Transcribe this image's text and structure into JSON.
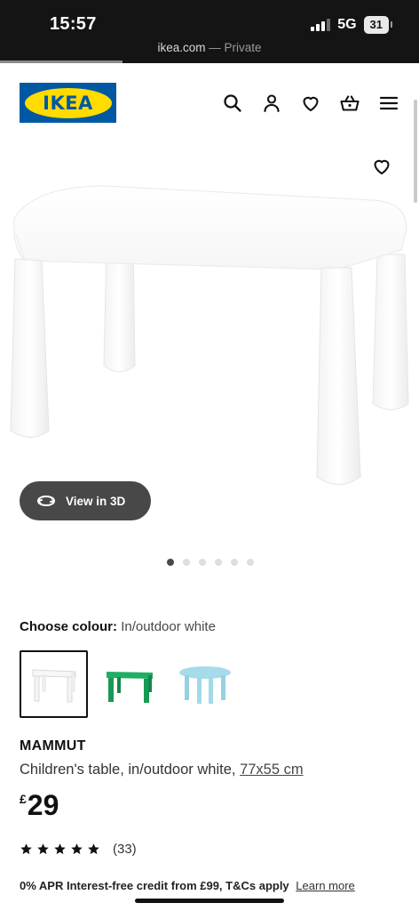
{
  "status_bar": {
    "time": "15:57",
    "network": "5G",
    "battery": "31"
  },
  "browser": {
    "domain": "ikea.com",
    "mode": "— Private"
  },
  "header": {
    "logo_text": "IKEA",
    "icons": [
      "search-icon",
      "user-icon",
      "heart-icon",
      "basket-icon",
      "menu-icon"
    ]
  },
  "hero": {
    "view_3d_label": "View in 3D",
    "carousel": {
      "total": 6,
      "active": 1
    }
  },
  "colour": {
    "label": "Choose colour:",
    "value": "In/outdoor white",
    "swatches": [
      {
        "name": "white",
        "color": "#f7f7f7",
        "shape": "rectangle",
        "selected": true
      },
      {
        "name": "green",
        "color": "#1fae63",
        "shape": "rectangle",
        "selected": false
      },
      {
        "name": "light-blue",
        "color": "#a6dce9",
        "shape": "round",
        "selected": false
      }
    ]
  },
  "product": {
    "name": "MAMMUT",
    "description": "Children's table, in/outdoor white,",
    "size": "77x55 cm",
    "currency": "£",
    "price": "29",
    "rating_stars": 5,
    "rating_count": "(33)",
    "credit_text": "0% APR Interest-free credit from £99, T&Cs apply",
    "credit_link": "Learn more"
  },
  "colors": {
    "ikea_blue": "#0058a3",
    "ikea_yellow": "#ffdb00",
    "pill_bg": "#484848"
  }
}
